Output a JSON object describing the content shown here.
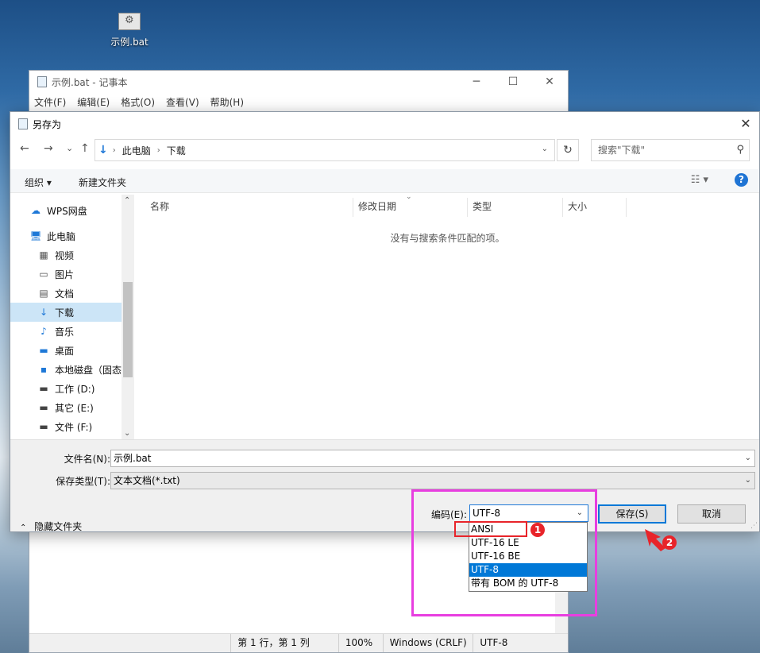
{
  "desktop": {
    "icon_label": "示例.bat"
  },
  "notepad": {
    "title": "示例.bat - 记事本",
    "controls": {
      "minimize": "─",
      "maximize": "☐",
      "close": "✕"
    },
    "menu": [
      "文件(F)",
      "编辑(E)",
      "格式(O)",
      "查看(V)",
      "帮助(H)"
    ],
    "status": {
      "position": "第 1 行，第 1 列",
      "zoom": "100%",
      "line_ending": "Windows (CRLF)",
      "encoding": "UTF-8"
    }
  },
  "dialog": {
    "title": "另存为",
    "close": "✕",
    "nav": {
      "back": "←",
      "forward": "→",
      "recent": "⌄",
      "up": "↑"
    },
    "breadcrumb": [
      "此电脑",
      "下载"
    ],
    "refresh": "↻",
    "search_placeholder": "搜索\"下载\"",
    "toolbar": {
      "organize": "组织 ▾",
      "new_folder": "新建文件夹",
      "help": "?"
    },
    "nav_items": [
      {
        "icon": "cloud-icon",
        "glyph": "☁",
        "label": "WPS网盘",
        "color": "#1e78d7"
      },
      {
        "icon": "computer-icon",
        "glyph": "🖥",
        "label": "此电脑",
        "color": "#1e78d7"
      },
      {
        "icon": "video-icon",
        "glyph": "▦",
        "label": "视频",
        "color": "#555"
      },
      {
        "icon": "picture-icon",
        "glyph": "▭",
        "label": "图片",
        "color": "#555"
      },
      {
        "icon": "document-icon",
        "glyph": "▤",
        "label": "文档",
        "color": "#555"
      },
      {
        "icon": "download-icon",
        "glyph": "↓",
        "label": "下载",
        "color": "#1e78d7"
      },
      {
        "icon": "music-icon",
        "glyph": "♪",
        "label": "音乐",
        "color": "#1e78d7"
      },
      {
        "icon": "desktop-icon",
        "glyph": "▬",
        "label": "桌面",
        "color": "#1e78d7"
      },
      {
        "icon": "drive-icon",
        "glyph": "▪",
        "label": "本地磁盘（固态",
        "color": "#1e78d7"
      },
      {
        "icon": "drive-icon",
        "glyph": "▬",
        "label": "工作 (D:)",
        "color": "#444"
      },
      {
        "icon": "drive-icon",
        "glyph": "▬",
        "label": "其它 (E:)",
        "color": "#444"
      },
      {
        "icon": "drive-icon",
        "glyph": "▬",
        "label": "文件 (F:)",
        "color": "#444"
      }
    ],
    "columns": [
      "名称",
      "修改日期",
      "类型",
      "大小"
    ],
    "empty_message": "没有与搜索条件匹配的项。",
    "filename_label": "文件名(N):",
    "filename_value": "示例.bat",
    "filetype_label": "保存类型(T):",
    "filetype_value": "文本文档(*.txt)",
    "hide_folders": "隐藏文件夹",
    "encoding_label": "编码(E):",
    "encoding_value": "UTF-8",
    "save_button": "保存(S)",
    "cancel_button": "取消"
  },
  "encoding_options": [
    "ANSI",
    "UTF-16 LE",
    "UTF-16 BE",
    "UTF-8",
    "带有 BOM 的 UTF-8"
  ],
  "encoding_selected": "UTF-8",
  "annotations": {
    "badge1": "1",
    "badge2": "2",
    "mark_color": "#e8242a",
    "box_color": "#e83ee0"
  },
  "colors": {
    "accent": "#0078d7",
    "selection": "#cce5f7"
  }
}
